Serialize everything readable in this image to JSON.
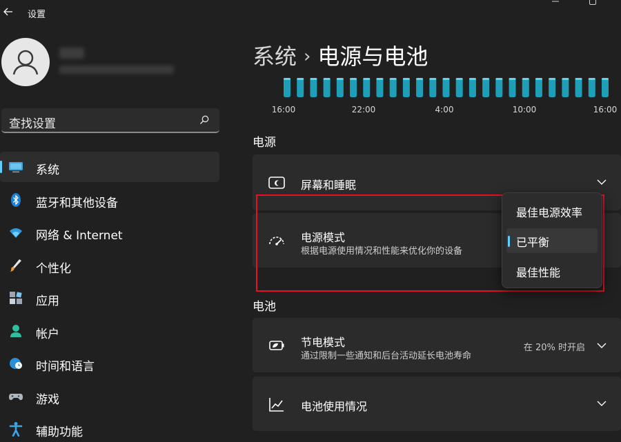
{
  "window": {
    "app_title": "设置",
    "back_icon": "arrow-left-icon",
    "controls": [
      "minimize-icon",
      "maximize-icon"
    ]
  },
  "profile": {
    "avatar_icon": "person-icon"
  },
  "search": {
    "placeholder": "查找设置",
    "icon": "search-icon"
  },
  "sidebar": {
    "items": [
      {
        "label": "系统",
        "icon": "monitor-icon",
        "active": true
      },
      {
        "label": "蓝牙和其他设备",
        "icon": "bluetooth-icon"
      },
      {
        "label": "网络 & Internet",
        "icon": "wifi-icon"
      },
      {
        "label": "个性化",
        "icon": "brush-icon"
      },
      {
        "label": "应用",
        "icon": "apps-icon"
      },
      {
        "label": "帐户",
        "icon": "account-icon"
      },
      {
        "label": "时间和语言",
        "icon": "globe-clock-icon"
      },
      {
        "label": "游戏",
        "icon": "gamepad-icon"
      },
      {
        "label": "辅助功能",
        "icon": "accessibility-icon"
      }
    ]
  },
  "header": {
    "parent": "系统",
    "separator": "›",
    "title": "电源与电池"
  },
  "chart_data": {
    "type": "bar",
    "x_ticks": [
      "16:00",
      "22:00",
      "4:00",
      "10:00",
      "16:00"
    ],
    "bar_count": 25,
    "values": [
      1,
      1,
      1,
      1,
      1,
      1,
      1,
      1,
      1,
      1,
      1,
      1,
      1,
      1,
      1,
      1,
      1,
      1,
      1,
      1,
      1,
      1,
      1,
      1,
      1
    ],
    "grid": false,
    "colors": {
      "bar": "#1e9eb7",
      "cap": "#66d4ee"
    }
  },
  "sections": {
    "power": "电源",
    "battery": "电池"
  },
  "cards": {
    "screen_sleep": {
      "title": "屏幕和睡眠",
      "icon": "screen-sleep-icon"
    },
    "power_mode": {
      "title": "电源模式",
      "subtitle": "根据电源使用情况和性能来优化你的设备",
      "icon": "speedometer-icon"
    },
    "battery_saver": {
      "title": "节电模式",
      "subtitle": "通过限制一些通知和后台活动延长电池寿命",
      "status": "在 20% 时开启",
      "icon": "battery-leaf-icon"
    },
    "battery_usage": {
      "title": "电池使用情况",
      "icon": "chart-line-icon"
    }
  },
  "dropdown": {
    "options": [
      "最佳电源效率",
      "已平衡",
      "最佳性能"
    ],
    "selected": "已平衡"
  },
  "colors": {
    "accent": "#60cdff",
    "highlight_border": "#e81123",
    "background": "#202020",
    "card": "#2b2b2b"
  }
}
